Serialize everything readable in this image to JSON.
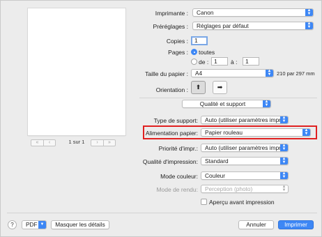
{
  "preview": {
    "page_info": "1 sur 1",
    "nav_first": "«",
    "nav_prev": "‹",
    "nav_next": "›",
    "nav_last": "»"
  },
  "printer": {
    "label": "Imprimante :",
    "value": "Canon"
  },
  "presets": {
    "label": "Préréglages :",
    "value": "Réglages par défaut"
  },
  "copies": {
    "label": "Copies :",
    "value": "1"
  },
  "pages": {
    "label": "Pages :",
    "all_label": "toutes",
    "from_label": "de :",
    "from_value": "1",
    "to_label": "à :",
    "to_value": "1"
  },
  "paper_size": {
    "label": "Taille du papier :",
    "value": "A4",
    "dimensions": "210 par 297 mm"
  },
  "orientation": {
    "label": "Orientation :",
    "portrait_icon": "portrait-orientation-icon",
    "landscape_icon": "landscape-orientation-icon"
  },
  "section": {
    "value": "Qualité et support"
  },
  "media_type": {
    "label": "Type de support:",
    "value": "Auto (utiliser paramètres impr.)"
  },
  "paper_source": {
    "label": "Alimentation papier:",
    "value": "Papier rouleau"
  },
  "print_priority": {
    "label": "Priorité d'impr.:",
    "value": "Auto (utiliser paramètres impr.)"
  },
  "print_quality": {
    "label": "Qualité d'impression:",
    "value": "Standard"
  },
  "color_mode": {
    "label": "Mode couleur:",
    "value": "Couleur"
  },
  "rendering": {
    "label": "Mode de rendu:",
    "value": "Perception (photo)"
  },
  "preview_option": {
    "label": "Aperçu avant impression"
  },
  "footer": {
    "help": "?",
    "pdf": "PDF",
    "hide_details": "Masquer les détails",
    "cancel": "Annuler",
    "print": "Imprimer"
  },
  "colors": {
    "accent": "#3d87f5",
    "highlight": "#e02020"
  }
}
